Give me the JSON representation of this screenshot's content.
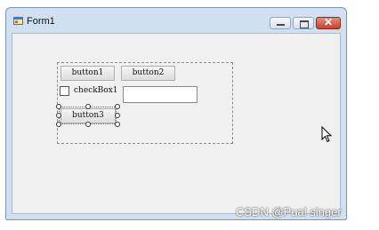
{
  "window": {
    "title": "Form1",
    "icon": "form-icon",
    "controls": {
      "minimize": "minimize-icon",
      "maximize": "maximize-icon",
      "close": "close-icon",
      "close_glyph": "✕"
    }
  },
  "designer": {
    "buttons": {
      "button1": "button1",
      "button2": "button2",
      "button3": "button3"
    },
    "checkbox_label": "checkBox1",
    "textbox_value": ""
  },
  "watermark": "CSDN @Pual singer",
  "colors": {
    "title_bar": "#cfe0f1",
    "close_button": "#c5422e",
    "client_area": "#f0f0f0"
  }
}
